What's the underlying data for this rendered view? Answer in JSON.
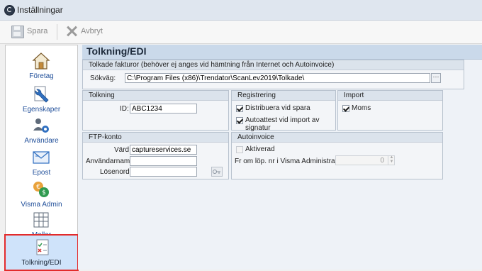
{
  "window": {
    "title": "Inställningar"
  },
  "toolbar": {
    "save_label": "Spara",
    "cancel_label": "Avbryt"
  },
  "sidebar": {
    "items": [
      {
        "label": "Företag"
      },
      {
        "label": "Egenskaper"
      },
      {
        "label": "Användare"
      },
      {
        "label": "Epost"
      },
      {
        "label": "Visma Admin"
      },
      {
        "label": "Mallar"
      },
      {
        "label": "Tolkning/EDI",
        "selected": true
      }
    ]
  },
  "page": {
    "title": "Tolkning/EDI"
  },
  "tolkade_fakturor": {
    "title": "Tolkade fakturor (behöver ej anges vid hämtning från Internet och Autoinvoice)",
    "path_label": "Sökväg:",
    "path_value": "C:\\Program Files (x86)\\Trendator\\ScanLev2019\\Tolkade\\",
    "browse_label": "···"
  },
  "tolkning": {
    "title": "Tolkning",
    "id_label": "ID:",
    "id_value": "ABC1234"
  },
  "registrering": {
    "title": "Registrering",
    "distribuera_label": "Distribuera vid spara",
    "distribuera_checked": true,
    "autoattest_label": "Autoattest vid import av signatur",
    "autoattest_checked": true
  },
  "import": {
    "title": "Import",
    "moms_label": "Moms",
    "moms_checked": true
  },
  "ftp": {
    "title": "FTP-konto",
    "host_label": "Värd:",
    "host_value": "captureservices.se",
    "user_label": "Användarnamn:",
    "user_value": "",
    "password_label": "Lösenord:",
    "password_value": ""
  },
  "autoinvoice": {
    "title": "Autoinvoice",
    "activated_label": "Aktiverad",
    "activated_checked": false,
    "from_label": "Fr om löp. nr i Visma Administration:",
    "from_value": "0"
  }
}
